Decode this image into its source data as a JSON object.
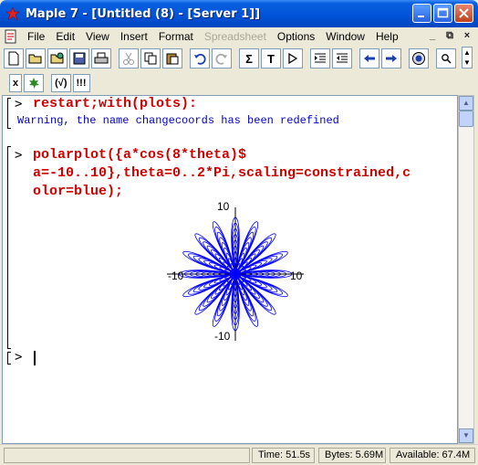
{
  "window": {
    "title": "Maple 7  - [Untitled (8) - [Server 1]]"
  },
  "menu": [
    {
      "label": "File",
      "disabled": false
    },
    {
      "label": "Edit",
      "disabled": false
    },
    {
      "label": "View",
      "disabled": false
    },
    {
      "label": "Insert",
      "disabled": false
    },
    {
      "label": "Format",
      "disabled": false
    },
    {
      "label": "Spreadsheet",
      "disabled": true
    },
    {
      "label": "Options",
      "disabled": false
    },
    {
      "label": "Window",
      "disabled": false
    },
    {
      "label": "Help",
      "disabled": false
    }
  ],
  "toolbar": {
    "sum_label": "Σ",
    "text_label": "T",
    "exec_label": "|>",
    "zoom_label": "🔍"
  },
  "toolbar2": {
    "x_label": "x",
    "check_label": "(√)",
    "excl_label": "!!!"
  },
  "worksheet": {
    "prompt": ">",
    "cmd1": "restart;with(plots):",
    "warning": "Warning, the name changecoords has been redefined",
    "cmd2_line1": "polarplot({a*cos(8*theta)$",
    "cmd2_line2": "a=-10..10},theta=0..2*Pi,scaling=constrained,c",
    "cmd2_line3": "olor=blue);",
    "prompt3": ">"
  },
  "chart_data": {
    "type": "line",
    "plot": "polar",
    "description_formula": "r = a*cos(8*theta), a = -10..10, theta = 0..2*Pi",
    "series_color": "#0000ff",
    "x_ticks": [
      "-10",
      "10"
    ],
    "y_ticks": [
      "10",
      "-10"
    ],
    "xlim": [
      -10,
      10
    ],
    "ylim": [
      -10,
      10
    ]
  },
  "status": {
    "time": "Time:  51.5s",
    "bytes": "Bytes: 5.69M",
    "available": "Available: 67.4M"
  }
}
